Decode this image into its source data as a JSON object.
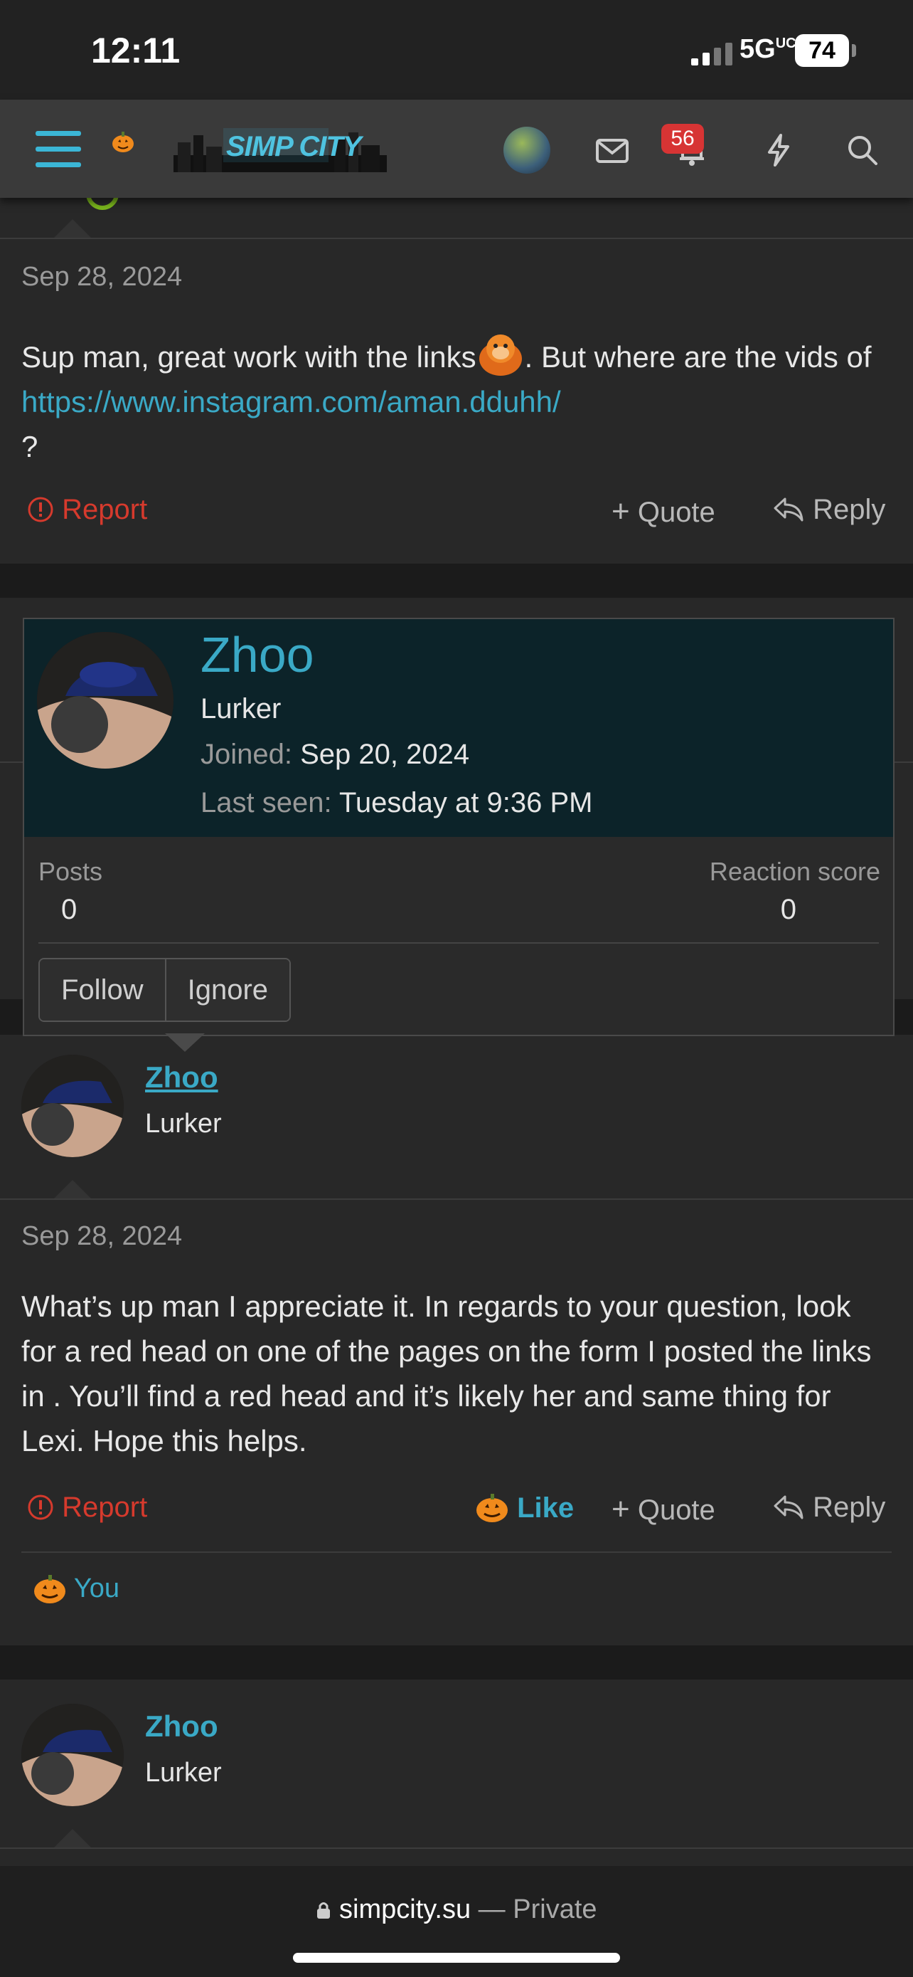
{
  "status": {
    "time": "12:11",
    "network": "5G",
    "network_suffix": "UC",
    "battery": "74"
  },
  "nav": {
    "logo_text": "SIMP CITY",
    "notification_count": "56"
  },
  "posts": [
    {
      "date": "Sep 28, 2024",
      "text_before_emoji": "Sup man, great work with the links",
      "text_after_emoji": ". But where are the vids of ",
      "link": "https://www.instagram.com/aman.dduhh/",
      "text_end": "?",
      "actions": {
        "report": "Report",
        "quote": "Quote",
        "reply": "Reply"
      }
    },
    {
      "username": "Zhoo",
      "role": "Lurker",
      "date": "Sep 28, 2024",
      "text": "What’s up man I appreciate it. In regards to your question, look for a red head on one of the pages on the form I posted the links in . You’ll find a red head and it’s likely her and same thing for Lexi. Hope this helps.",
      "actions": {
        "report": "Report",
        "like": "Like",
        "quote": "Quote",
        "reply": "Reply"
      },
      "reactions": "You"
    },
    {
      "username": "Zhoo",
      "role": "Lurker"
    }
  ],
  "popup": {
    "name": "Zhoo",
    "role": "Lurker",
    "joined_label": "Joined:",
    "joined": "Sep 20, 2024",
    "last_seen_label": "Last seen:",
    "last_seen": "Tuesday at 9:36 PM",
    "posts_label": "Posts",
    "posts": "0",
    "reaction_label": "Reaction score",
    "reaction": "0",
    "follow": "Follow",
    "ignore": "Ignore"
  },
  "browser": {
    "domain": "simpcity.su",
    "separator": " — ",
    "mode": "Private"
  },
  "colors": {
    "accent": "#3aa9c6",
    "report": "#d63a2d",
    "badge": "#d73434",
    "popup_header": "#0c2329"
  }
}
